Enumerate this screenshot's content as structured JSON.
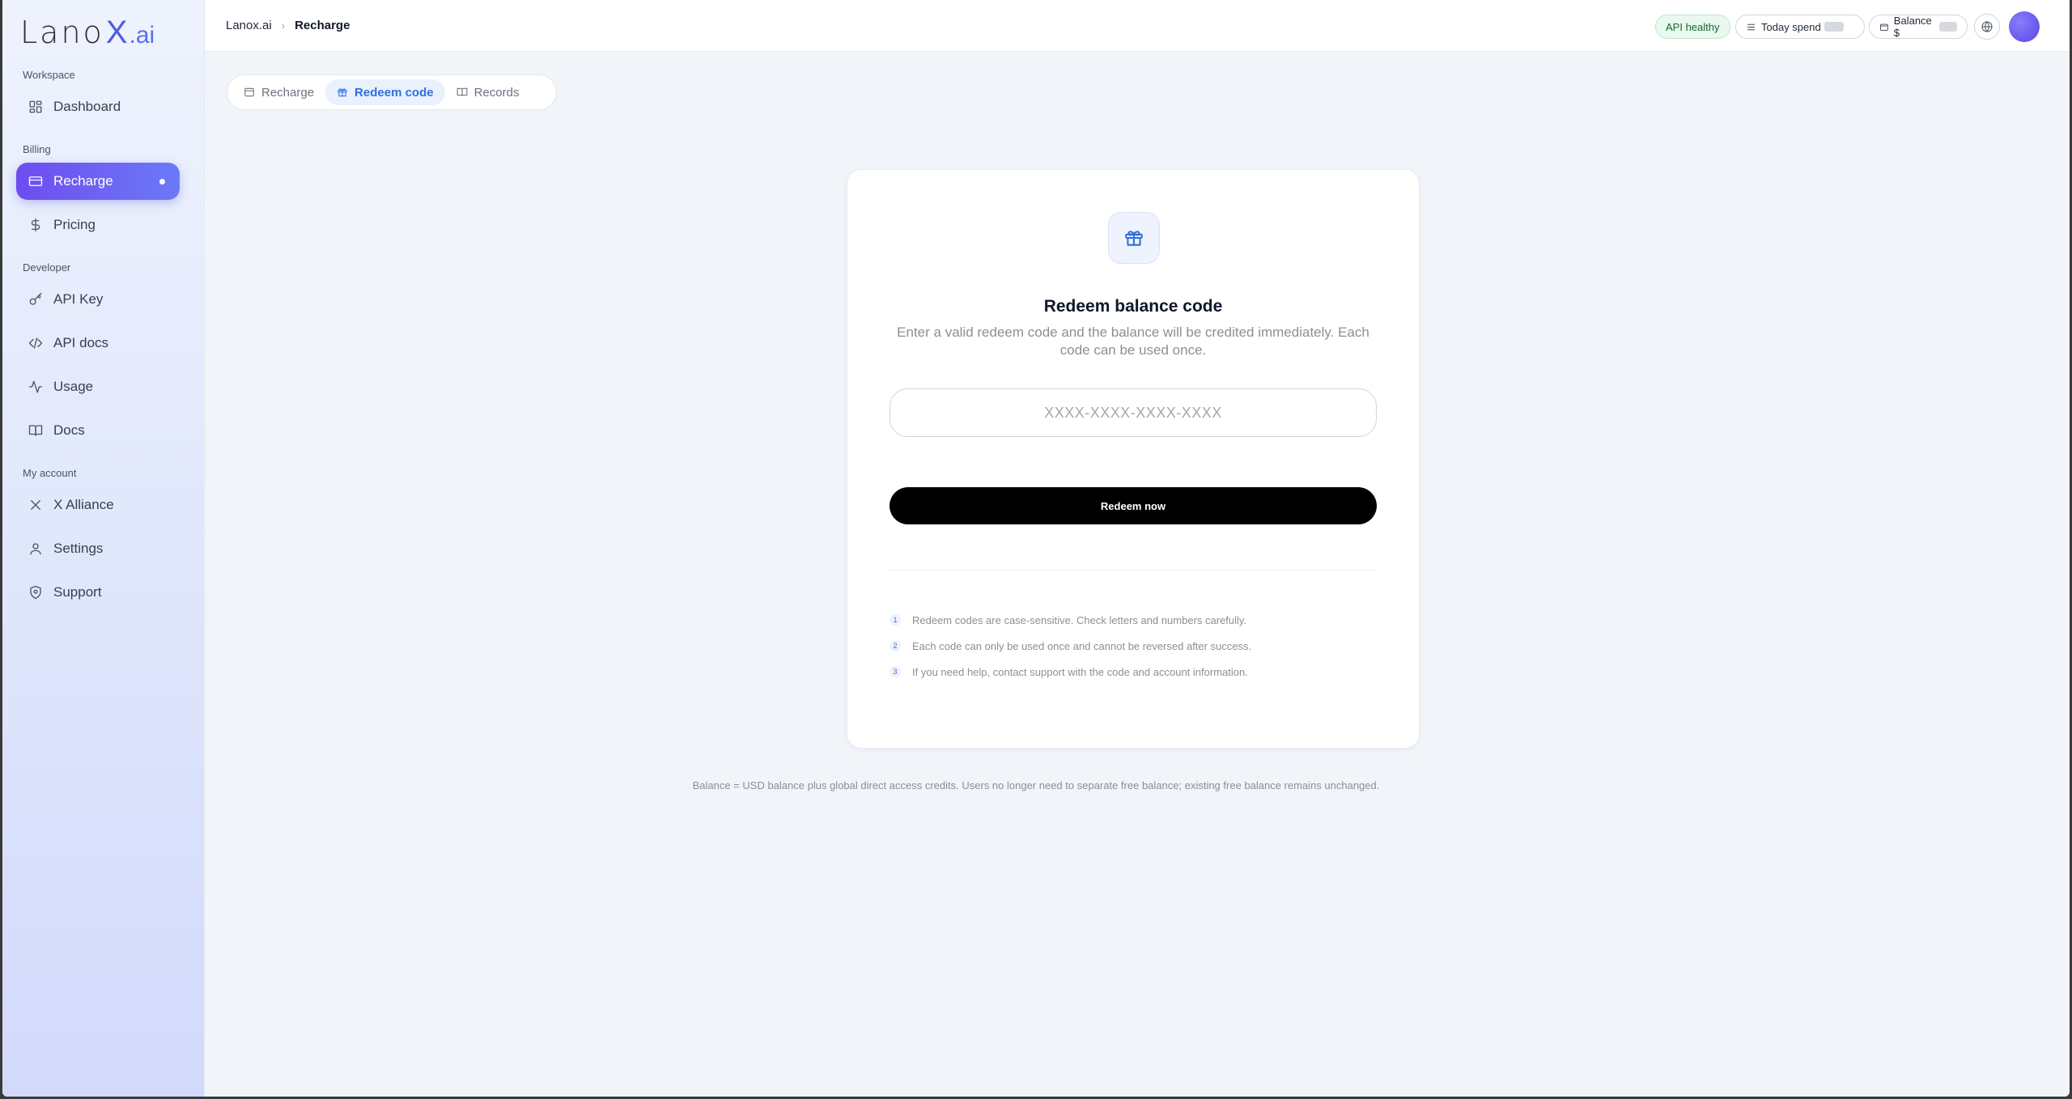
{
  "logo": {
    "main": "Lano",
    "x": "X",
    "ai": ".ai"
  },
  "sidebar": {
    "sections": [
      {
        "label": "Workspace"
      },
      {
        "label": "Billing"
      },
      {
        "label": "Developer"
      },
      {
        "label": "My account"
      }
    ],
    "items": [
      {
        "label": "Dashboard",
        "icon": "dashboard-icon"
      },
      {
        "label": "Recharge",
        "icon": "card-icon",
        "active": true
      },
      {
        "label": "Pricing",
        "icon": "dollar-icon"
      },
      {
        "label": "API Key",
        "icon": "key-icon"
      },
      {
        "label": "API docs",
        "icon": "code-icon"
      },
      {
        "label": "Usage",
        "icon": "activity-icon"
      },
      {
        "label": "Docs",
        "icon": "book-icon"
      },
      {
        "label": "X Alliance",
        "icon": "x-icon"
      },
      {
        "label": "Settings",
        "icon": "user-icon"
      },
      {
        "label": "Support",
        "icon": "shield-icon"
      }
    ]
  },
  "topbar": {
    "breadcrumb": {
      "root": "Lanox.ai",
      "current": "Recharge"
    },
    "api_status": "API healthy",
    "today_spend_label": "Today spend",
    "balance_label": "Balance $"
  },
  "tabs": [
    {
      "label": "Recharge",
      "icon": "wallet-icon"
    },
    {
      "label": "Redeem code",
      "icon": "gift-icon",
      "active": true
    },
    {
      "label": "Records",
      "icon": "book-icon"
    }
  ],
  "redeem": {
    "title": "Redeem balance code",
    "description": "Enter a valid redeem code and the balance will be credited immediately. Each code can be used once.",
    "input_placeholder": "XXXX-XXXX-XXXX-XXXX",
    "input_value": "",
    "button_label": "Redeem now",
    "tips": [
      {
        "num": "1",
        "text": "Redeem codes are case-sensitive. Check letters and numbers carefully."
      },
      {
        "num": "2",
        "text": "Each code can only be used once and cannot be reversed after success."
      },
      {
        "num": "3",
        "text": "If you need help, contact support with the code and account information."
      }
    ]
  },
  "footnote": "Balance = USD balance plus global direct access credits. Users no longer need to separate free balance; existing free balance remains unchanged.",
  "colors": {
    "accent": "#2f6fe0",
    "active_nav_start": "#6f4cf0",
    "active_nav_end": "#6b7af7",
    "status_green": "#166534"
  }
}
